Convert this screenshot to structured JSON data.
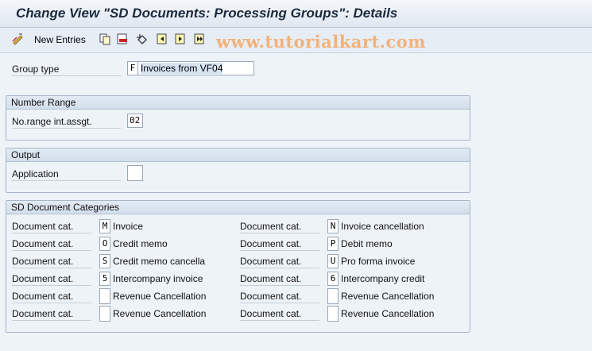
{
  "window": {
    "title": "Change View \"SD Documents: Processing Groups\": Details"
  },
  "toolbar": {
    "new_entries_label": "New Entries",
    "watermark": "www.tutorialkart.com",
    "icons": [
      "edit-icon",
      "copy-icon",
      "delete-icon",
      "undo-icon",
      "first-page-icon",
      "previous-page-icon",
      "next-page-icon"
    ]
  },
  "group_type": {
    "label": "Group type",
    "value": "F",
    "description": "Invoices from VF04"
  },
  "number_range": {
    "title": "Number Range",
    "label": "No.range int.assgt.",
    "value": "02"
  },
  "output": {
    "title": "Output",
    "label": "Application",
    "value": ""
  },
  "categories": {
    "title": "SD Document Categories",
    "left": [
      {
        "label": "Document cat.",
        "value": "M",
        "description": "Invoice"
      },
      {
        "label": "Document cat.",
        "value": "O",
        "description": "Credit memo"
      },
      {
        "label": "Document cat.",
        "value": "S",
        "description": "Credit memo cancella"
      },
      {
        "label": "Document cat.",
        "value": "5",
        "description": "Intercompany invoice"
      },
      {
        "label": "Document cat.",
        "value": "",
        "description": "Revenue Cancellation"
      },
      {
        "label": "Document cat.",
        "value": "",
        "description": "Revenue Cancellation"
      }
    ],
    "right": [
      {
        "label": "Document cat.",
        "value": "N",
        "description": "Invoice cancellation"
      },
      {
        "label": "Document cat.",
        "value": "P",
        "description": "Debit memo"
      },
      {
        "label": "Document cat.",
        "value": "U",
        "description": "Pro forma invoice"
      },
      {
        "label": "Document cat.",
        "value": "6",
        "description": "Intercompany credit"
      },
      {
        "label": "Document cat.",
        "value": "",
        "description": "Revenue Cancellation"
      },
      {
        "label": "Document cat.",
        "value": "",
        "description": "Revenue Cancellation"
      }
    ]
  }
}
